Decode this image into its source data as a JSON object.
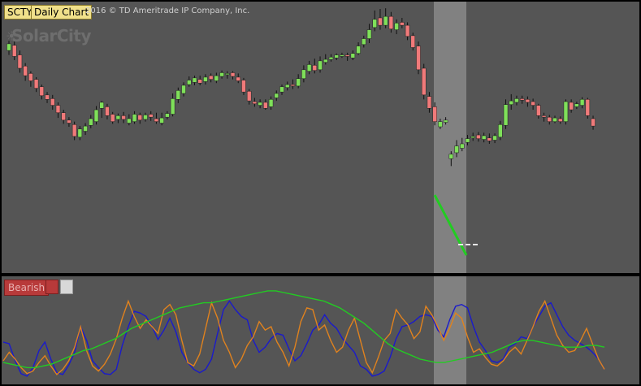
{
  "header": {
    "symbol": "SCTY",
    "period": "Daily Chart",
    "copyright": "2016 © TD Ameritrade IP Company, Inc.",
    "logo_text": "SolarCity"
  },
  "indicator": {
    "signal_label": "Bearish"
  },
  "colors": {
    "up_candle": "#7fe05a",
    "down_candle": "#f07a7a",
    "blue_line": "#1a1acc",
    "orange_line": "#e0821e",
    "green_line": "#22cc22",
    "highlight": "#8a8a8a",
    "signal_bearish": "#b83a3a"
  },
  "chart_data": [
    {
      "type": "candlestick",
      "candles": [
        {
          "o": 296,
          "c": 305,
          "h": 309,
          "l": 290
        },
        {
          "o": 303,
          "c": 288,
          "h": 308,
          "l": 283
        },
        {
          "o": 290,
          "c": 272,
          "h": 296,
          "l": 266
        },
        {
          "o": 275,
          "c": 262,
          "h": 279,
          "l": 255
        },
        {
          "o": 265,
          "c": 255,
          "h": 268,
          "l": 247
        },
        {
          "o": 257,
          "c": 245,
          "h": 260,
          "l": 240
        },
        {
          "o": 247,
          "c": 235,
          "h": 250,
          "l": 230
        },
        {
          "o": 236,
          "c": 230,
          "h": 240,
          "l": 225
        },
        {
          "o": 231,
          "c": 222,
          "h": 236,
          "l": 216
        },
        {
          "o": 222,
          "c": 212,
          "h": 226,
          "l": 205
        },
        {
          "o": 212,
          "c": 202,
          "h": 216,
          "l": 197
        },
        {
          "o": 202,
          "c": 198,
          "h": 206,
          "l": 193
        },
        {
          "o": 196,
          "c": 180,
          "h": 200,
          "l": 175
        },
        {
          "o": 179,
          "c": 190,
          "h": 194,
          "l": 175
        },
        {
          "o": 187,
          "c": 194,
          "h": 198,
          "l": 182
        },
        {
          "o": 195,
          "c": 204,
          "h": 209,
          "l": 191
        },
        {
          "o": 200,
          "c": 216,
          "h": 221,
          "l": 196
        },
        {
          "o": 218,
          "c": 226,
          "h": 228,
          "l": 205
        },
        {
          "o": 220,
          "c": 208,
          "h": 224,
          "l": 203
        },
        {
          "o": 210,
          "c": 200,
          "h": 213,
          "l": 197
        },
        {
          "o": 203,
          "c": 208,
          "h": 211,
          "l": 198
        },
        {
          "o": 208,
          "c": 203,
          "h": 213,
          "l": 198
        },
        {
          "o": 198,
          "c": 204,
          "h": 210,
          "l": 195
        },
        {
          "o": 200,
          "c": 210,
          "h": 214,
          "l": 197
        },
        {
          "o": 209,
          "c": 202,
          "h": 212,
          "l": 197
        },
        {
          "o": 203,
          "c": 209,
          "h": 212,
          "l": 200
        },
        {
          "o": 210,
          "c": 206,
          "h": 214,
          "l": 201
        },
        {
          "o": 204,
          "c": 200,
          "h": 212,
          "l": 197
        },
        {
          "o": 198,
          "c": 205,
          "h": 212,
          "l": 195
        },
        {
          "o": 206,
          "c": 211,
          "h": 214,
          "l": 203
        },
        {
          "o": 210,
          "c": 231,
          "h": 238,
          "l": 207
        },
        {
          "o": 230,
          "c": 242,
          "h": 246,
          "l": 225
        },
        {
          "o": 238,
          "c": 249,
          "h": 253,
          "l": 234
        },
        {
          "o": 250,
          "c": 256,
          "h": 261,
          "l": 247
        },
        {
          "o": 253,
          "c": 259,
          "h": 262,
          "l": 249
        },
        {
          "o": 257,
          "c": 252,
          "h": 262,
          "l": 249
        },
        {
          "o": 254,
          "c": 260,
          "h": 264,
          "l": 250
        },
        {
          "o": 262,
          "c": 257,
          "h": 265,
          "l": 253
        },
        {
          "o": 255,
          "c": 262,
          "h": 266,
          "l": 252
        },
        {
          "o": 261,
          "c": 266,
          "h": 269,
          "l": 258
        },
        {
          "o": 265,
          "c": 265,
          "h": 268,
          "l": 258
        },
        {
          "o": 266,
          "c": 261,
          "h": 268,
          "l": 257
        },
        {
          "o": 260,
          "c": 255,
          "h": 265,
          "l": 252
        },
        {
          "o": 256,
          "c": 240,
          "h": 259,
          "l": 236
        },
        {
          "o": 241,
          "c": 228,
          "h": 244,
          "l": 223
        },
        {
          "o": 227,
          "c": 224,
          "h": 232,
          "l": 220
        },
        {
          "o": 222,
          "c": 226,
          "h": 230,
          "l": 218
        },
        {
          "o": 226,
          "c": 218,
          "h": 230,
          "l": 216
        },
        {
          "o": 220,
          "c": 230,
          "h": 234,
          "l": 216
        },
        {
          "o": 232,
          "c": 238,
          "h": 242,
          "l": 228
        },
        {
          "o": 240,
          "c": 247,
          "h": 250,
          "l": 236
        },
        {
          "o": 246,
          "c": 250,
          "h": 254,
          "l": 242
        },
        {
          "o": 250,
          "c": 248,
          "h": 257,
          "l": 244
        },
        {
          "o": 248,
          "c": 258,
          "h": 264,
          "l": 245
        },
        {
          "o": 258,
          "c": 270,
          "h": 276,
          "l": 253
        },
        {
          "o": 268,
          "c": 277,
          "h": 282,
          "l": 264
        },
        {
          "o": 276,
          "c": 269,
          "h": 285,
          "l": 265
        },
        {
          "o": 270,
          "c": 282,
          "h": 288,
          "l": 266
        },
        {
          "o": 280,
          "c": 284,
          "h": 291,
          "l": 277
        },
        {
          "o": 284,
          "c": 287,
          "h": 291,
          "l": 281
        },
        {
          "o": 286,
          "c": 290,
          "h": 292,
          "l": 283
        },
        {
          "o": 288,
          "c": 290,
          "h": 293,
          "l": 286
        },
        {
          "o": 290,
          "c": 288,
          "h": 293,
          "l": 282
        },
        {
          "o": 286,
          "c": 292,
          "h": 296,
          "l": 283
        },
        {
          "o": 292,
          "c": 302,
          "h": 307,
          "l": 290
        },
        {
          "o": 304,
          "c": 312,
          "h": 316,
          "l": 300
        },
        {
          "o": 312,
          "c": 324,
          "h": 332,
          "l": 306
        },
        {
          "o": 327,
          "c": 338,
          "h": 350,
          "l": 322
        },
        {
          "o": 340,
          "c": 330,
          "h": 352,
          "l": 324
        },
        {
          "o": 330,
          "c": 342,
          "h": 353,
          "l": 326
        },
        {
          "o": 342,
          "c": 325,
          "h": 348,
          "l": 320
        },
        {
          "o": 324,
          "c": 333,
          "h": 338,
          "l": 318
        },
        {
          "o": 334,
          "c": 330,
          "h": 340,
          "l": 326
        },
        {
          "o": 330,
          "c": 315,
          "h": 334,
          "l": 310
        },
        {
          "o": 316,
          "c": 300,
          "h": 320,
          "l": 296
        },
        {
          "o": 302,
          "c": 270,
          "h": 308,
          "l": 264
        },
        {
          "o": 272,
          "c": 236,
          "h": 278,
          "l": 230
        },
        {
          "o": 234,
          "c": 218,
          "h": 240,
          "l": 212
        },
        {
          "o": 220,
          "c": 200,
          "h": 226,
          "l": 195
        },
        {
          "o": 193,
          "c": 200,
          "h": 204,
          "l": 190
        },
        {
          "o": 199,
          "c": 202,
          "h": 206,
          "l": 196
        },
        {
          "o": 150,
          "c": 156,
          "h": 160,
          "l": 140
        },
        {
          "o": 158,
          "c": 167,
          "h": 175,
          "l": 152
        },
        {
          "o": 164,
          "c": 170,
          "h": 178,
          "l": 160
        },
        {
          "o": 172,
          "c": 177,
          "h": 182,
          "l": 168
        },
        {
          "o": 178,
          "c": 180,
          "h": 185,
          "l": 174
        },
        {
          "o": 182,
          "c": 177,
          "h": 186,
          "l": 173
        },
        {
          "o": 176,
          "c": 181,
          "h": 185,
          "l": 172
        },
        {
          "o": 178,
          "c": 174,
          "h": 184,
          "l": 170
        },
        {
          "o": 175,
          "c": 181,
          "h": 184,
          "l": 171
        },
        {
          "o": 179,
          "c": 196,
          "h": 201,
          "l": 175
        },
        {
          "o": 195,
          "c": 223,
          "h": 230,
          "l": 190
        },
        {
          "o": 223,
          "c": 228,
          "h": 237,
          "l": 216
        },
        {
          "o": 226,
          "c": 231,
          "h": 235,
          "l": 222
        },
        {
          "o": 231,
          "c": 229,
          "h": 235,
          "l": 224
        },
        {
          "o": 230,
          "c": 226,
          "h": 234,
          "l": 220
        },
        {
          "o": 227,
          "c": 222,
          "h": 231,
          "l": 216
        },
        {
          "o": 222,
          "c": 208,
          "h": 224,
          "l": 204
        },
        {
          "o": 208,
          "c": 206,
          "h": 212,
          "l": 200
        },
        {
          "o": 206,
          "c": 200,
          "h": 209,
          "l": 196
        },
        {
          "o": 200,
          "c": 205,
          "h": 208,
          "l": 198
        },
        {
          "o": 204,
          "c": 200,
          "h": 207,
          "l": 197
        },
        {
          "o": 200,
          "c": 227,
          "h": 230,
          "l": 196
        },
        {
          "o": 226,
          "c": 216,
          "h": 230,
          "l": 212
        },
        {
          "o": 220,
          "c": 224,
          "h": 227,
          "l": 217
        },
        {
          "o": 222,
          "c": 230,
          "h": 233,
          "l": 218
        },
        {
          "o": 230,
          "c": 208,
          "h": 232,
          "l": 204
        },
        {
          "o": 204,
          "c": 194,
          "h": 208,
          "l": 189
        }
      ]
    },
    {
      "type": "line",
      "series": [
        {
          "values": [
            42,
            40,
            20,
            5,
            2,
            12,
            32,
            42,
            22,
            6,
            4,
            15,
            30,
            60,
            44,
            20,
            12,
            5,
            4,
            10,
            38,
            60,
            78,
            76,
            72,
            60,
            45,
            56,
            70,
            54,
            30,
            18,
            10,
            6,
            10,
            22,
            52,
            80,
            90,
            80,
            72,
            68,
            44,
            30,
            36,
            46,
            52,
            50,
            34,
            20,
            26,
            40,
            56,
            62,
            74,
            64,
            58,
            46,
            38,
            30,
            14,
            10,
            2,
            4,
            8,
            24,
            46,
            60,
            62,
            66,
            72,
            74,
            72,
            56,
            48,
            68,
            84,
            86,
            82,
            60,
            42,
            32,
            20,
            18,
            22,
            36,
            40,
            48,
            46,
            60,
            72,
            84,
            88,
            74,
            60,
            50,
            44,
            40,
            36,
            30,
            22,
            10
          ]
        },
        {
          "values": [
            20,
            30,
            22,
            12,
            5,
            8,
            18,
            26,
            14,
            4,
            10,
            20,
            36,
            60,
            32,
            14,
            8,
            16,
            28,
            46,
            70,
            90,
            72,
            58,
            68,
            60,
            52,
            80,
            86,
            74,
            44,
            18,
            14,
            28,
            58,
            88,
            70,
            44,
            30,
            12,
            22,
            38,
            48,
            66,
            56,
            60,
            42,
            30,
            14,
            36,
            66,
            82,
            80,
            56,
            62,
            44,
            30,
            36,
            56,
            70,
            44,
            18,
            6,
            24,
            44,
            52,
            80,
            70,
            62,
            46,
            54,
            84,
            74,
            60,
            44,
            58,
            76,
            70,
            48,
            30,
            34,
            24,
            16,
            14,
            20,
            30,
            36,
            28,
            44,
            60,
            78,
            90,
            70,
            50,
            38,
            30,
            32,
            44,
            58,
            40,
            22,
            10
          ]
        },
        {
          "values": [
            18,
            16,
            14,
            12,
            12,
            14,
            16,
            20,
            24,
            28,
            32,
            34,
            38,
            42,
            46,
            52,
            58,
            62,
            66,
            70,
            74,
            78,
            82,
            84,
            86,
            88,
            88,
            90,
            92,
            94,
            96,
            98,
            100,
            102,
            102,
            100,
            98,
            96,
            94,
            92,
            90,
            86,
            82,
            76,
            70,
            64,
            56,
            48,
            40,
            34,
            30,
            26,
            22,
            20,
            18,
            18,
            20,
            22,
            24,
            26,
            28,
            30,
            34,
            38,
            42,
            44,
            44,
            42,
            40,
            38,
            36,
            36,
            36,
            38,
            38,
            36
          ]
        }
      ]
    }
  ]
}
